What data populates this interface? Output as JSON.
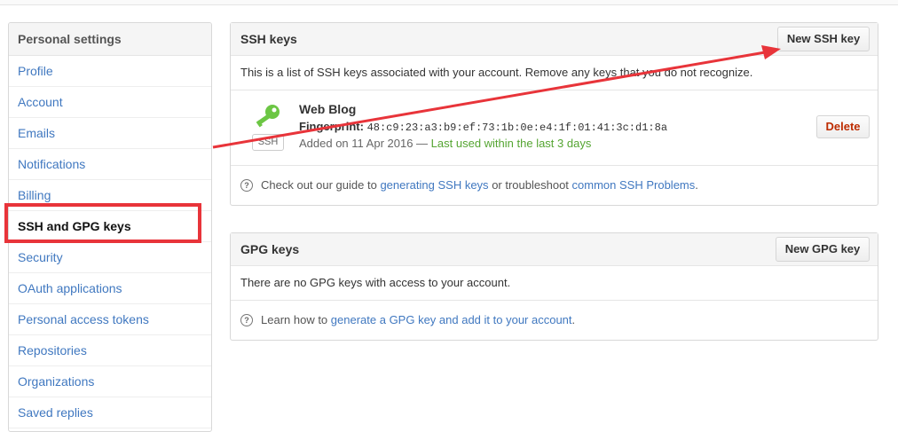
{
  "sidebar": {
    "header": "Personal settings",
    "items": [
      {
        "label": "Profile"
      },
      {
        "label": "Account"
      },
      {
        "label": "Emails"
      },
      {
        "label": "Notifications"
      },
      {
        "label": "Billing"
      },
      {
        "label": "SSH and GPG keys"
      },
      {
        "label": "Security"
      },
      {
        "label": "OAuth applications"
      },
      {
        "label": "Personal access tokens"
      },
      {
        "label": "Repositories"
      },
      {
        "label": "Organizations"
      },
      {
        "label": "Saved replies"
      }
    ]
  },
  "ssh": {
    "title": "SSH keys",
    "new_button": "New SSH key",
    "description": "This is a list of SSH keys associated with your account. Remove any keys that you do not recognize.",
    "key": {
      "name": "Web Blog",
      "badge": "SSH",
      "fingerprint_label": "Fingerprint:",
      "fingerprint": "48:c9:23:a3:b9:ef:73:1b:0e:e4:1f:01:41:3c:d1:8a",
      "added": "Added on 11 Apr 2016 —",
      "last_used": "Last used within the last 3 days",
      "delete_button": "Delete"
    },
    "help": {
      "prefix": "Check out our guide to",
      "link1": "generating SSH keys",
      "middle": "or troubleshoot",
      "link2": "common SSH Problems",
      "suffix": "."
    }
  },
  "gpg": {
    "title": "GPG keys",
    "new_button": "New GPG key",
    "description": "There are no GPG keys with access to your account.",
    "help": {
      "prefix": "Learn how to",
      "link": "generate a GPG key and add it to your account",
      "suffix": "."
    }
  },
  "colors": {
    "link": "#4078c0",
    "delete": "#bd2c00",
    "key_icon": "#6cc644",
    "annotation": "#e8343a",
    "last_used": "#55a532"
  },
  "icons": {
    "key": "key-icon",
    "help": "question-icon"
  }
}
